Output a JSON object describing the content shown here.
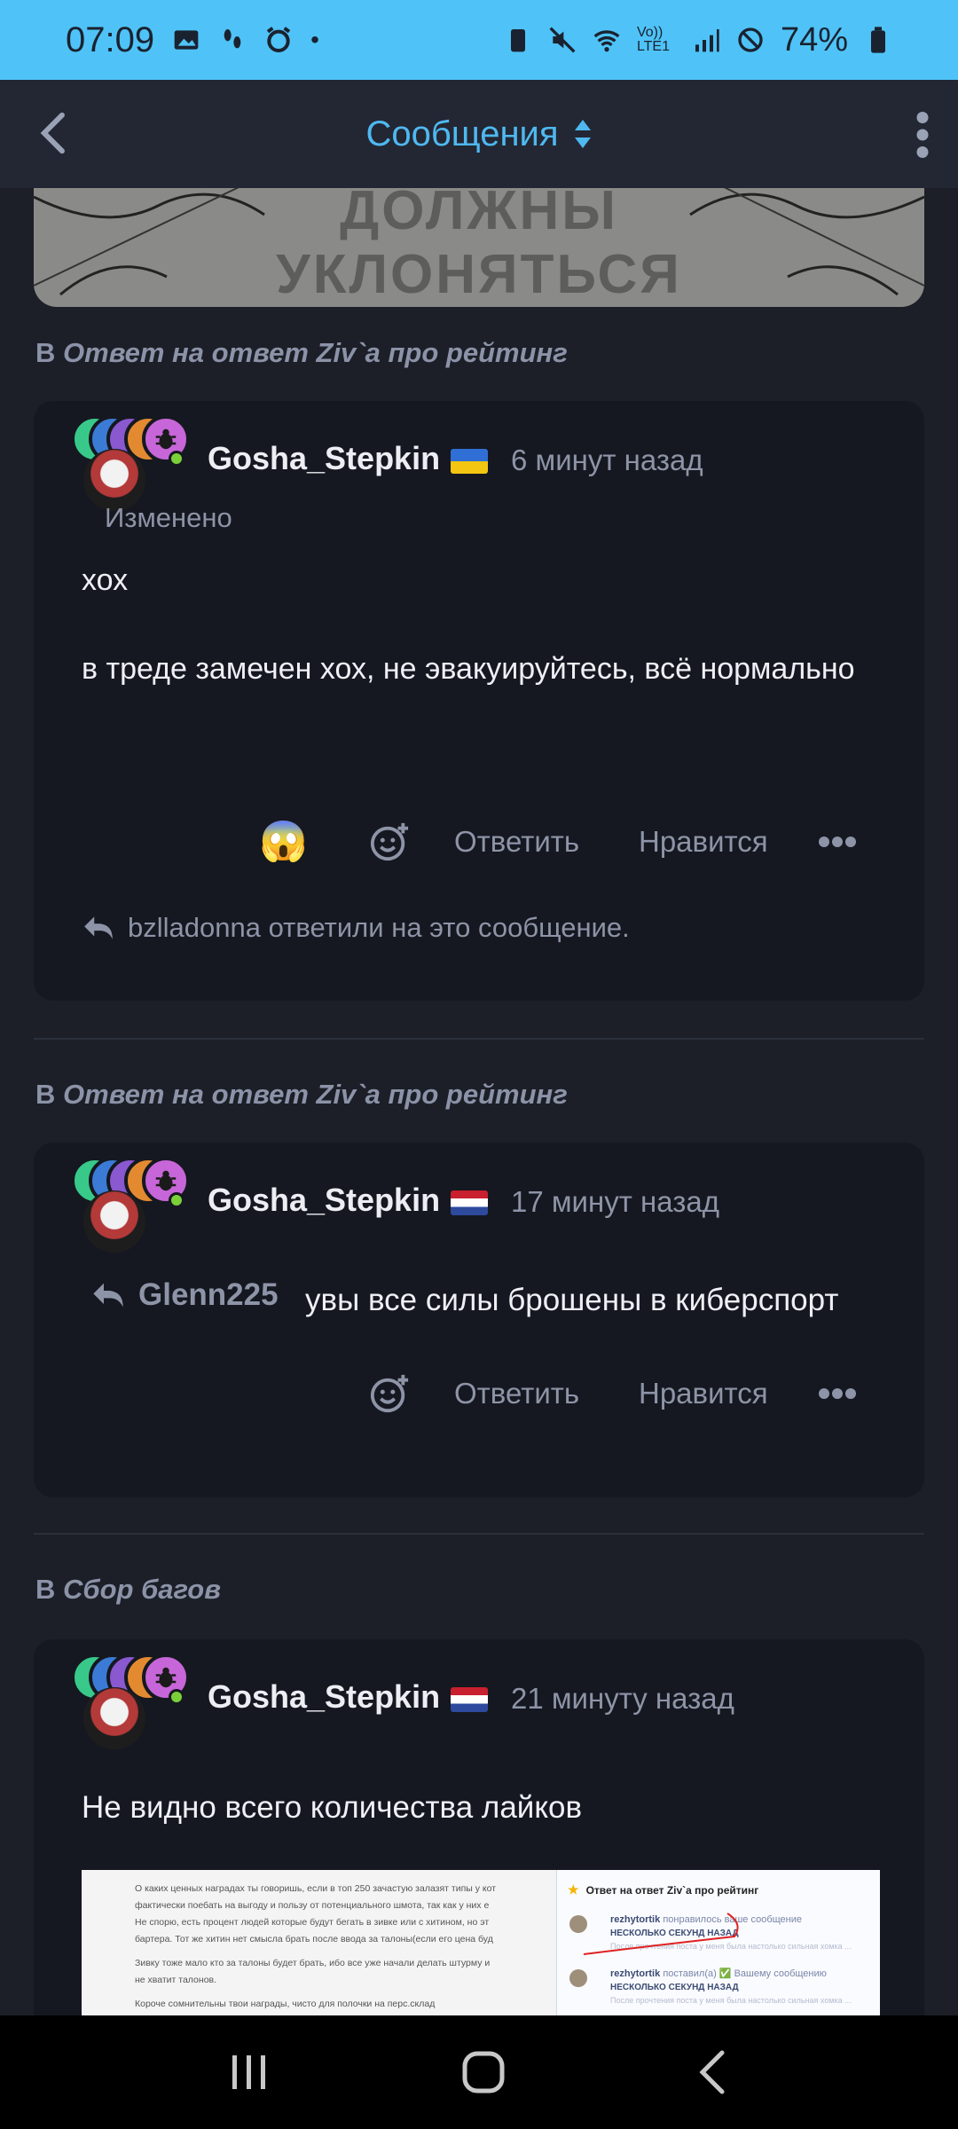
{
  "status_bar": {
    "time": "07:09",
    "battery": "74%",
    "network": "Vo)) LTE1"
  },
  "header": {
    "title": "Сообщения"
  },
  "top_image": {
    "line1": "ДОЛЖНЫ",
    "line2": "УКЛОНЯТЬСЯ"
  },
  "posts": [
    {
      "in_prefix": "В",
      "topic": "Ответ на ответ Ziv`a про рейтинг",
      "username": "Gosha_Stepkin",
      "time": "6 минут назад",
      "edited": "Изменено",
      "message1": "хох",
      "message2": "в треде замечен хох, не эвакуируйтесь, всё нормально",
      "reaction": "😱",
      "reply_label": "Ответить",
      "like_label": "Нравится",
      "reply_note": "bzlladonna ответили на это сообщение."
    },
    {
      "in_prefix": "В",
      "topic": "Ответ на ответ Ziv`a про рейтинг",
      "username": "Gosha_Stepkin",
      "time": "17 минут назад",
      "quote_user": "Glenn225",
      "message": "увы все силы брошены в киберспорт",
      "reply_label": "Ответить",
      "like_label": "Нравится"
    },
    {
      "in_prefix": "В",
      "topic": "Сбор багов",
      "username": "Gosha_Stepkin",
      "time": "21 минуту назад",
      "message": "Не видно всего количества лайков",
      "screenshot": {
        "left_text": [
          "О каких ценных наградах ты говоришь, если в топ 250 зачастую залазят типы у кот",
          "фактически поебать на выгоду и пользу от потенциального шмота, так как у них е",
          "Не спорю, есть процент людей которые будут бегать в зивке или с хитином, но эт",
          "бартера. Тот же хитин нет смысла брать после ввода за талоны(если его цена буд",
          "Зивку тоже мало кто за талоны будет брать, ибо все уже начали делать штурму и",
          "не хватит талонов.",
          "Короче сомнительны твои награды, чисто для полочки на перс.склад"
        ],
        "panel_title": "Ответ на ответ Ziv`a про рейтинг",
        "items": [
          {
            "user": "rezhytortik",
            "action": "понравилось ваше сообщение",
            "time": "НЕСКОЛЬКО СЕКУНД НАЗАД",
            "preview": "После прочтения поста у меня была настолько сильная хомка ..."
          },
          {
            "user": "rezhytortik",
            "action": "поставил(а) ✅ Вашему сообщению",
            "time": "НЕСКОЛЬКО СЕКУНД НАЗАД",
            "preview": "После прочтения поста у меня была настолько сильная хомка ..."
          }
        ]
      }
    }
  ],
  "colors": {
    "status_bar": "#4fc3f7",
    "header_title": "#4fb8f0",
    "background": "#1c1f27",
    "card": "#151820"
  }
}
